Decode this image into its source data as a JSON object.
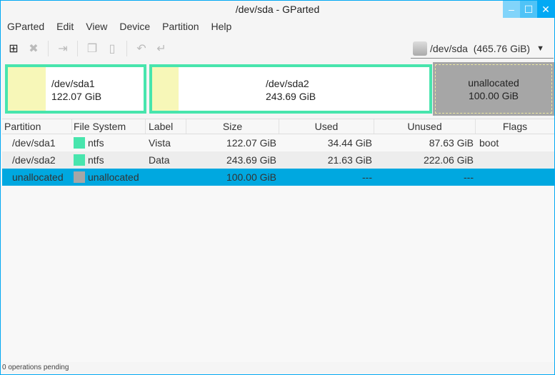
{
  "window": {
    "title": "/dev/sda - GParted",
    "min": "–",
    "max": "☐",
    "close": "✕"
  },
  "menu": [
    "GParted",
    "Edit",
    "View",
    "Device",
    "Partition",
    "Help"
  ],
  "device": {
    "name": "/dev/sda",
    "size": "(465.76 GiB)"
  },
  "map": [
    {
      "name": "/dev/sda1",
      "size": "122.07 GiB",
      "used_fraction": 0.28
    },
    {
      "name": "/dev/sda2",
      "size": "243.69 GiB",
      "used_fraction": 0.09
    },
    {
      "name": "unallocated",
      "size": "100.00 GiB"
    }
  ],
  "columns": [
    "Partition",
    "File System",
    "Label",
    "Size",
    "Used",
    "Unused",
    "Flags"
  ],
  "rows": [
    {
      "partition": "/dev/sda1",
      "fs": "ntfs",
      "fs_color": "#48e5ad",
      "label": "Vista",
      "size": "122.07 GiB",
      "used": "34.44 GiB",
      "unused": "87.63 GiB",
      "flags": "boot"
    },
    {
      "partition": "/dev/sda2",
      "fs": "ntfs",
      "fs_color": "#48e5ad",
      "label": "Data",
      "size": "243.69 GiB",
      "used": "21.63 GiB",
      "unused": "222.06 GiB",
      "flags": ""
    },
    {
      "partition": "unallocated",
      "fs": "unallocated",
      "fs_color": "#a6a6a6",
      "label": "",
      "size": "100.00 GiB",
      "used": "---",
      "unused": "---",
      "flags": ""
    }
  ],
  "status": "0 operations pending"
}
